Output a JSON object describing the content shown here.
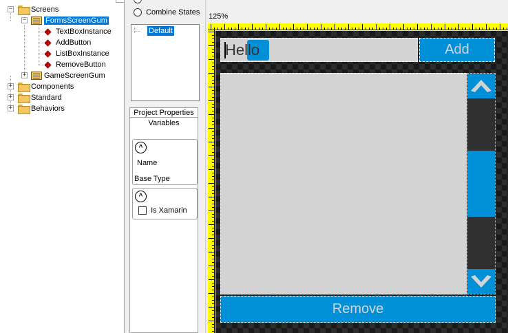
{
  "tree": {
    "items": [
      {
        "label": "Screens",
        "icon": "folder-icon"
      },
      {
        "label": "FormsScreenGum",
        "icon": "screen-icon",
        "selected": true
      },
      {
        "label": "TextBoxInstance",
        "icon": "instance-icon"
      },
      {
        "label": "AddButton",
        "icon": "instance-icon"
      },
      {
        "label": "ListBoxInstance",
        "icon": "instance-icon"
      },
      {
        "label": "RemoveButton",
        "icon": "instance-icon"
      },
      {
        "label": "GameScreenGum",
        "icon": "screen-icon"
      },
      {
        "label": "Components",
        "icon": "folder-icon"
      },
      {
        "label": "Standard",
        "icon": "folder-icon"
      },
      {
        "label": "Behaviors",
        "icon": "folder-icon"
      }
    ]
  },
  "states": {
    "combine_label": "Combine States",
    "default_state": "Default"
  },
  "properties": {
    "tab_label": "Project Properties",
    "variables_heading": "Variables",
    "name_label": "Name",
    "base_type_label": "Base Type",
    "is_xamarin_label": "Is Xamarin"
  },
  "canvas": {
    "zoom": "125%",
    "textbox_value": "Hello",
    "add_label": "Add",
    "remove_label": "Remove"
  },
  "colors": {
    "accent": "#0090d8",
    "control_bg": "#d3d3d3",
    "ruler": "#ffff00",
    "selection": "#0078d7"
  }
}
